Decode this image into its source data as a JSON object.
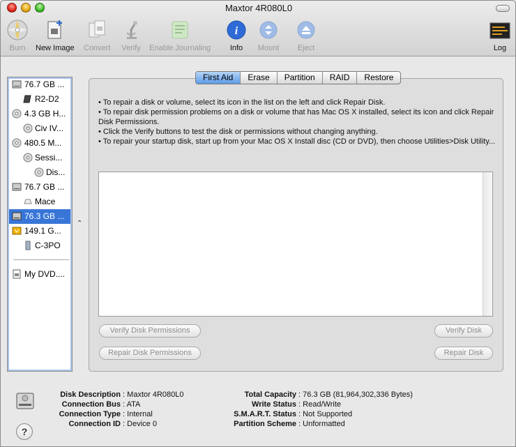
{
  "window": {
    "title": "Maxtor 4R080L0"
  },
  "toolbar": {
    "items": [
      {
        "label": "Burn",
        "icon": "burn-icon",
        "enabled": false
      },
      {
        "label": "New Image",
        "icon": "new-image-icon",
        "enabled": true
      },
      {
        "label": "Convert",
        "icon": "convert-icon",
        "enabled": false
      },
      {
        "label": "Verify",
        "icon": "verify-icon",
        "enabled": false
      },
      {
        "label": "Enable Journaling",
        "icon": "journaling-icon",
        "enabled": false
      },
      {
        "label": "Info",
        "icon": "info-icon",
        "enabled": true
      },
      {
        "label": "Mount",
        "icon": "mount-icon",
        "enabled": false
      },
      {
        "label": "Eject",
        "icon": "eject-icon",
        "enabled": false
      },
      {
        "label": "Log",
        "icon": "log-icon",
        "enabled": true
      }
    ]
  },
  "sidebar": {
    "items": [
      {
        "label": "76.7 GB ...",
        "icon": "hard-drive-icon",
        "indent": 0,
        "selected": false
      },
      {
        "label": "R2-D2",
        "icon": "volume-icon",
        "indent": 1,
        "selected": false
      },
      {
        "label": "4.3 GB H...",
        "icon": "optical-disc-icon",
        "indent": 0,
        "selected": false
      },
      {
        "label": "Civ IV...",
        "icon": "optical-disc-icon",
        "indent": 1,
        "selected": false
      },
      {
        "label": "480.5 M...",
        "icon": "optical-disc-icon",
        "indent": 0,
        "selected": false
      },
      {
        "label": "Sessi...",
        "icon": "optical-disc-icon",
        "indent": 1,
        "selected": false
      },
      {
        "label": "Dis...",
        "icon": "optical-disc-icon",
        "indent": 2,
        "selected": false
      },
      {
        "label": "76.7 GB ...",
        "icon": "hard-drive-icon",
        "indent": 0,
        "selected": false
      },
      {
        "label": "Mace",
        "icon": "volume-icon",
        "indent": 1,
        "selected": false
      },
      {
        "label": "76.3 GB ...",
        "icon": "hard-drive-icon",
        "indent": 0,
        "selected": true
      },
      {
        "label": "149.1 G...",
        "icon": "external-drive-icon",
        "indent": 0,
        "selected": false
      },
      {
        "label": "C-3PO",
        "icon": "volume-icon",
        "indent": 1,
        "selected": false
      }
    ],
    "images": [
      {
        "label": "My DVD....",
        "icon": "disk-image-icon"
      }
    ]
  },
  "tabs": [
    {
      "label": "First Aid",
      "active": true
    },
    {
      "label": "Erase",
      "active": false
    },
    {
      "label": "Partition",
      "active": false
    },
    {
      "label": "RAID",
      "active": false
    },
    {
      "label": "Restore",
      "active": false
    }
  ],
  "first_aid": {
    "instructions": [
      "• To repair a disk or volume, select its icon in the list on the left and click Repair Disk.",
      "• To repair disk permission problems on a disk or volume that has Mac OS X installed, select its icon and click Repair Disk Permissions.",
      "• Click the Verify buttons to test the disk or permissions without changing anything.",
      "• To repair your startup disk, start up from your Mac OS X Install disc (CD or DVD), then choose Utilities>Disk Utility..."
    ],
    "verify_permissions_label": "Verify Disk Permissions",
    "repair_permissions_label": "Repair Disk Permissions",
    "verify_disk_label": "Verify Disk",
    "repair_disk_label": "Repair Disk"
  },
  "info": {
    "left": [
      {
        "key": "Disk Description",
        "value": "Maxtor 4R080L0"
      },
      {
        "key": "Connection Bus",
        "value": "ATA"
      },
      {
        "key": "Connection Type",
        "value": "Internal"
      },
      {
        "key": "Connection ID",
        "value": "Device 0"
      }
    ],
    "right": [
      {
        "key": "Total Capacity",
        "value": "76.3 GB (81,964,302,336 Bytes)"
      },
      {
        "key": "Write Status",
        "value": "Read/Write"
      },
      {
        "key": "S.M.A.R.T. Status",
        "value": "Not Supported"
      },
      {
        "key": "Partition Scheme",
        "value": "Unformatted"
      }
    ],
    "help_label": "?"
  },
  "colors": {
    "selection": "#3875d7",
    "active_tab": "#5d9be8"
  }
}
